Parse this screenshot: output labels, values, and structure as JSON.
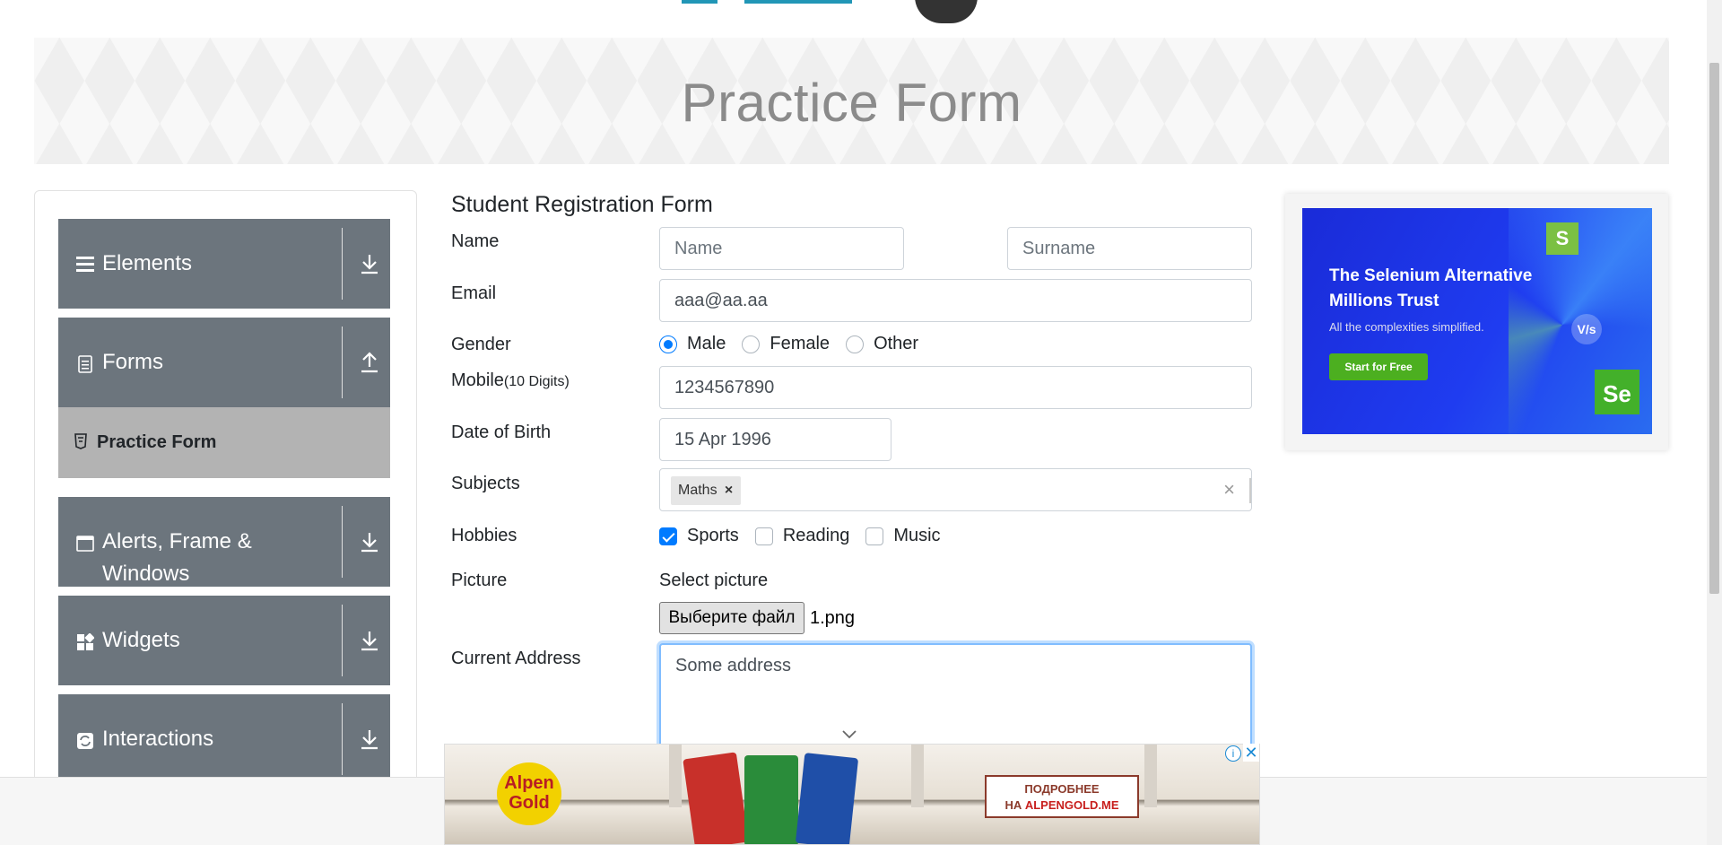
{
  "page": {
    "heading": "Practice Form"
  },
  "sidebar": {
    "groups": [
      {
        "label": "Elements",
        "arrow": "down"
      },
      {
        "label": "Forms",
        "arrow": "up"
      },
      {
        "label": "Alerts, Frame &",
        "label2": "Windows",
        "arrow": "down"
      },
      {
        "label": "Widgets",
        "arrow": "down"
      },
      {
        "label": "Interactions",
        "arrow": "down"
      }
    ],
    "active_item": "Practice Form"
  },
  "form": {
    "title": "Student Registration Form",
    "name_label": "Name",
    "first_name_placeholder": "Name",
    "last_name_placeholder": "Surname",
    "email_label": "Email",
    "email_value": "aaa@aa.aa",
    "gender_label": "Gender",
    "gender_options": [
      "Male",
      "Female",
      "Other"
    ],
    "gender_selected": "Male",
    "mobile_label": "Mobile",
    "mobile_hint": "(10 Digits)",
    "mobile_value": "1234567890",
    "dob_label": "Date of Birth",
    "dob_value": "15 Apr 1996",
    "subjects_label": "Subjects",
    "subjects": [
      "Maths"
    ],
    "hobbies_label": "Hobbies",
    "hobbies": [
      {
        "label": "Sports",
        "checked": true
      },
      {
        "label": "Reading",
        "checked": false
      },
      {
        "label": "Music",
        "checked": false
      }
    ],
    "picture_label": "Picture",
    "picture_hint": "Select picture",
    "file_button": "Выберите файл",
    "file_name": "1.png",
    "address_label": "Current Address",
    "address_value": "Some address"
  },
  "ad_right": {
    "headline_1": "The Selenium Alternative",
    "headline_2": "Millions Trust",
    "subline": "All the complexities simplified.",
    "cta": "Start for Free",
    "badge_s": "S",
    "badge_vs": "V/s",
    "badge_se": "Se"
  },
  "ad_bottom": {
    "brand_1": "Alpen",
    "brand_2": "Gold",
    "more_1": "ПОДРОБНЕЕ",
    "more_2_prefix": "НА ",
    "more_2_site": "ALPENGOLD.ME"
  },
  "colors": {
    "accent": "#007bff",
    "sidebar_group": "#6c757d",
    "sidebar_active": "#b3b3b3"
  }
}
